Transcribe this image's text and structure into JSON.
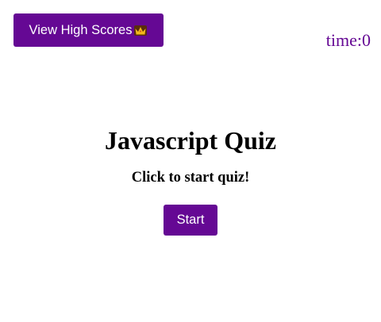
{
  "header": {
    "high_scores_label": "View High Scores",
    "high_scores_icon": "crown-icon",
    "timer_text": "time:0"
  },
  "main": {
    "title": "Javascript Quiz",
    "subtitle": "Click to start quiz!",
    "start_label": "Start"
  },
  "colors": {
    "accent": "#650894",
    "button_text": "#ffffff",
    "background": "#ffffff",
    "heading_text": "#000000",
    "crown_gold": "#f2b81b"
  }
}
